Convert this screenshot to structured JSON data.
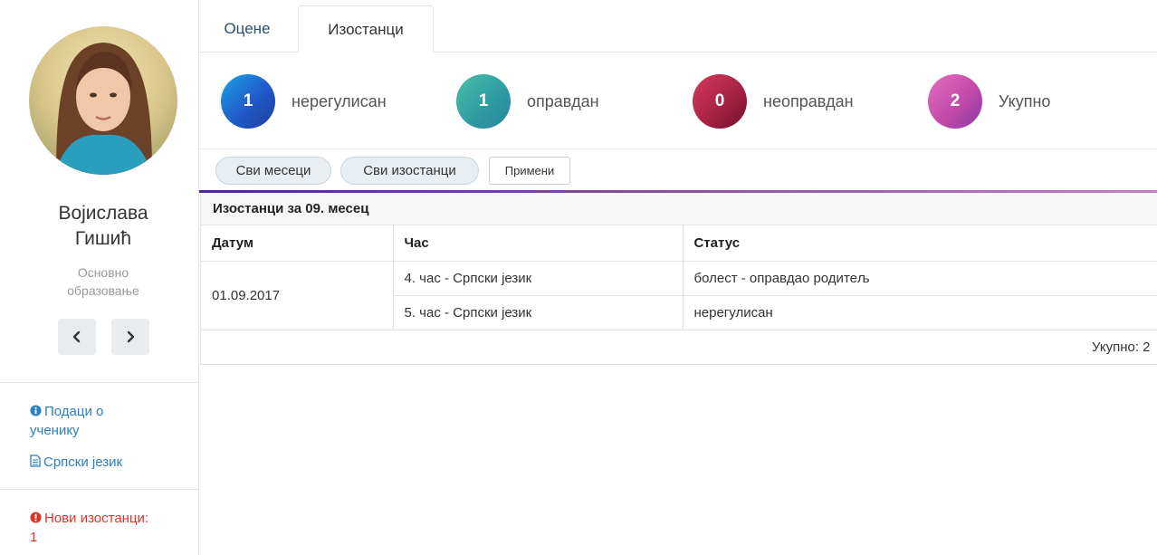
{
  "student": {
    "name_line1": "Војислава",
    "name_line2": "Гишић",
    "school_line1": "Основно",
    "school_line2": "образовање"
  },
  "sidebar": {
    "links": [
      {
        "icon": "info-circle-icon",
        "label_line1": "Подаци о",
        "label_line2": "ученику"
      },
      {
        "icon": "document-icon",
        "label": "Српски језик"
      }
    ],
    "alert": {
      "icon": "exclamation-circle-icon",
      "label_line1": "Нови изостанци:",
      "label_line2": "1",
      "color": "#d9342b"
    }
  },
  "tabs": [
    {
      "label": "Оцене",
      "active": false
    },
    {
      "label": "Изостанци",
      "active": true
    }
  ],
  "stats": [
    {
      "value": "1",
      "label": "нерегулисан",
      "color": "#2159c9"
    },
    {
      "value": "1",
      "label": "оправдан",
      "color": "#2d9aa2"
    },
    {
      "value": "0",
      "label": "неоправдан",
      "color": "#a82344"
    },
    {
      "value": "2",
      "label": "Укупно",
      "color": "#c24aa9"
    }
  ],
  "filters": {
    "month": "Сви месеци",
    "type": "Сви изостанци",
    "apply": "Примени"
  },
  "table": {
    "caption": "Изостанци за 09. месец",
    "headers": [
      "Датум",
      "Час",
      "Статус"
    ],
    "date": "01.09.2017",
    "rows": [
      {
        "class": "4. час - Српски језик",
        "status": "болест - оправдао родитељ"
      },
      {
        "class": "5. час - Српски језик",
        "status": "нерегулисан"
      }
    ],
    "total": "Укупно: 2"
  }
}
